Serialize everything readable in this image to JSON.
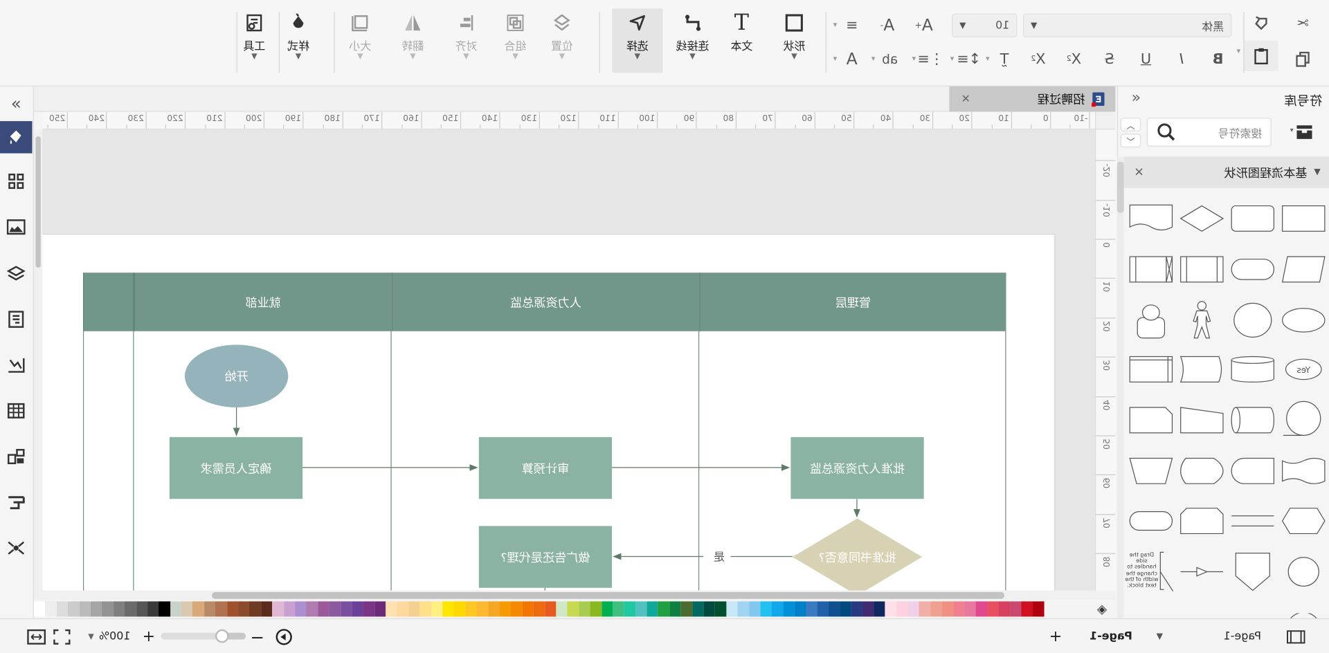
{
  "toolbar": {
    "font_family": "黑体",
    "font_size": "10",
    "big_buttons": [
      {
        "label": "形状",
        "icon": "rectangle-icon"
      },
      {
        "label": "文本",
        "icon": "text-icon"
      },
      {
        "label": "连接线",
        "icon": "connector-icon"
      },
      {
        "label": "选择",
        "icon": "pointer-icon"
      },
      {
        "label": "位置",
        "icon": "position-icon"
      },
      {
        "label": "组合",
        "icon": "group-icon"
      },
      {
        "label": "对齐",
        "icon": "align-icon"
      },
      {
        "label": "翻转",
        "icon": "flip-icon"
      },
      {
        "label": "大小",
        "icon": "size-icon"
      },
      {
        "label": "样式",
        "icon": "style-icon"
      },
      {
        "label": "工具",
        "icon": "tools-icon"
      }
    ]
  },
  "library": {
    "title": "符号库",
    "search_placeholder": "搜索符号",
    "section": "基本流程图形状",
    "yes_label": "Yes",
    "note_text": "Drag the side handles to change the width of the text block."
  },
  "document_tab": {
    "title": "招聘过程"
  },
  "ruler": {
    "horizontal": [
      "-10",
      "0",
      "10",
      "20",
      "30",
      "40",
      "50",
      "60",
      "70",
      "80",
      "90",
      "100",
      "110",
      "120",
      "130",
      "140",
      "150",
      "160",
      "170",
      "180",
      "190",
      "200",
      "210",
      "220",
      "230",
      "240",
      "250"
    ],
    "vertical": [
      "-20",
      "-10",
      "0",
      "10",
      "20",
      "30",
      "40",
      "50",
      "60",
      "70",
      "80"
    ]
  },
  "diagram": {
    "lanes": [
      "管理层",
      "人力资源总监",
      "就业部"
    ],
    "nodes": {
      "start": "开始",
      "determine_needs": "确定人员需求",
      "audit_budget": "审计预算",
      "approve_hr": "批准人力资源总监",
      "decision": "批准书同意否?",
      "ad_or_agent": "做广告还是代理?"
    },
    "edge_yes": "是",
    "colors": {
      "header": "#71968a",
      "process": "#8ab3a3",
      "start": "#94b3bb",
      "decision": "#d8d2b4",
      "line": "#5f7a66"
    }
  },
  "palette": [
    "#ffffff",
    "#eeeeee",
    "#dddddd",
    "#cccccc",
    "#bbbbbb",
    "#a5a5a5",
    "#939393",
    "#7f7f7f",
    "#6b6b6b",
    "#555555",
    "#3a3a3a",
    "#000000",
    "#c9d3c9",
    "#d9c9b0",
    "#d9a978",
    "#b98a68",
    "#b0724f",
    "#a0522d",
    "#8b4a2b",
    "#6f3b22",
    "#5a2a1a",
    "#e0b8d6",
    "#c9a0d2",
    "#ac8fcf",
    "#b07bb0",
    "#9a5a9a",
    "#8b5a9e",
    "#7b4fa0",
    "#6b3f9a",
    "#7a3585",
    "#6b2a75",
    "#ffe0b0",
    "#ffd8a0",
    "#f5d090",
    "#ffe088",
    "#fff080",
    "#ffe600",
    "#ffd800",
    "#ffc820",
    "#ffb830",
    "#f5a623",
    "#f59a00",
    "#f58a00",
    "#f27600",
    "#ee6a10",
    "#e65a20",
    "#d0e8c8",
    "#c8d850",
    "#a8cc50",
    "#8ab820",
    "#00b050",
    "#40c080",
    "#20c8a0",
    "#50c0c0",
    "#10a898",
    "#20a040",
    "#108040",
    "#4a6a30",
    "#006a60",
    "#004a40",
    "#005030",
    "#c8e8f8",
    "#a0d4f0",
    "#80c8f0",
    "#20c0f0",
    "#10a8e8",
    "#0090d8",
    "#0080c8",
    "#3a7ac0",
    "#2060a8",
    "#105090",
    "#004a80",
    "#2a3a80",
    "#402a70",
    "#102860",
    "#ffe0e8",
    "#ffd0e0",
    "#f0d0e8",
    "#f0b0a8",
    "#f0a090",
    "#f09080",
    "#f08090",
    "#e878a0",
    "#e04890",
    "#e85060",
    "#d84060",
    "#c84870",
    "#d01020",
    "#b00010"
  ],
  "status": {
    "page_selector": "Page-1",
    "page_tab": "Page-1",
    "zoom": "100%",
    "zoom_slider_percent": 50
  },
  "accent_color": "#3a4a7a"
}
